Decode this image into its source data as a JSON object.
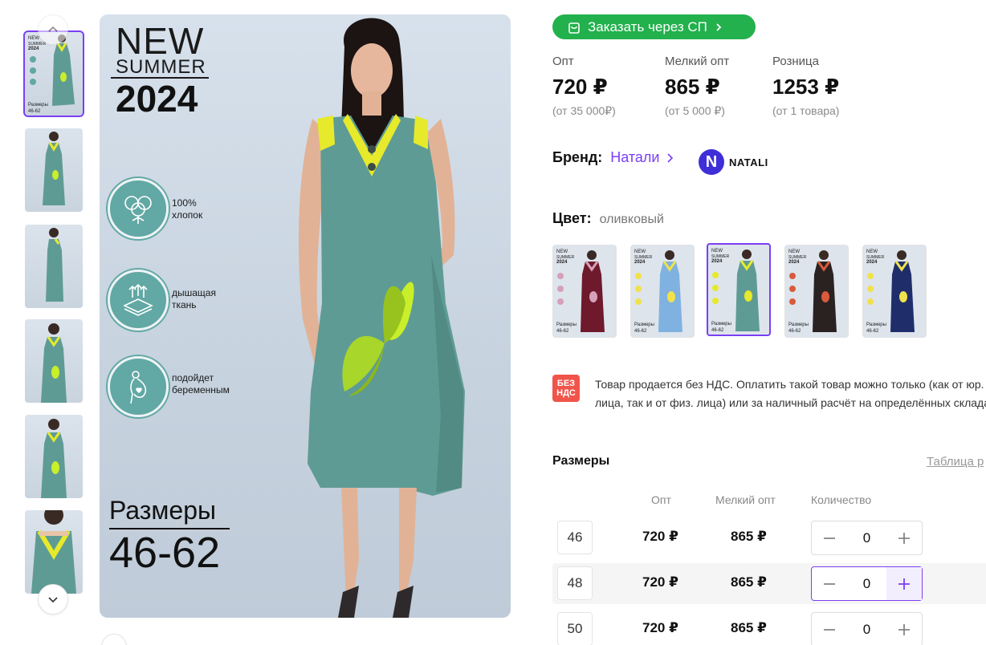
{
  "gallery": {
    "promo_new": "NEW",
    "promo_summer": "SUMMER",
    "promo_year": "2024",
    "features": [
      {
        "icon": "cotton-icon",
        "text": "100%\nхлопок"
      },
      {
        "icon": "breathable-fabric-icon",
        "text": "дышащая\nткань"
      },
      {
        "icon": "pregnant-icon",
        "text": "подойдет\nбеременным"
      }
    ],
    "sizes_title": "Размеры",
    "sizes_range": "46-62",
    "thumb_sizes_caption": "Размеры\n46-62"
  },
  "order_button": {
    "label": "Заказать через СП",
    "icon": "shopping-bag-icon"
  },
  "prices": [
    {
      "label": "Опт",
      "value": "720 ₽",
      "note": "(от 35 000₽)"
    },
    {
      "label": "Мелкий опт",
      "value": "865 ₽",
      "note": "(от 5 000 ₽)"
    },
    {
      "label": "Розница",
      "value": "1253 ₽",
      "note": "(от 1 товара)"
    }
  ],
  "brand": {
    "label": "Бренд:",
    "name": "Натали",
    "logo_letter": "N",
    "logo_text": "NATALI",
    "logo_color": "#3f2fd8"
  },
  "color": {
    "label": "Цвет:",
    "value": "оливковый",
    "swatches": [
      {
        "name": "burgundy",
        "dress": "#6e1a2c",
        "accent": "#d6a0b8"
      },
      {
        "name": "light-blue",
        "dress": "#7fb2e0",
        "accent": "#f0e24a"
      },
      {
        "name": "olive",
        "dress": "#5f9b95",
        "accent": "#e6ea2a"
      },
      {
        "name": "black-floral",
        "dress": "#2a2220",
        "accent": "#d95a3c"
      },
      {
        "name": "navy",
        "dress": "#1f2e6b",
        "accent": "#f0e24a"
      }
    ]
  },
  "nds": {
    "badge": "БЕЗ НДС",
    "text": "Товар продается без НДС. Оплатить такой товар можно только (как от юр. лица, так и от физ. лица) или за наличный расчёт на определённых складах"
  },
  "sizes": {
    "title": "Размеры",
    "table_link": "Таблица р",
    "headers": {
      "opt": "Опт",
      "small_opt": "Мелкий опт",
      "qty": "Количество"
    },
    "rows": [
      {
        "size": "46",
        "opt": "720 ₽",
        "small_opt": "865 ₽",
        "qty": "0"
      },
      {
        "size": "48",
        "opt": "720 ₽",
        "small_opt": "865 ₽",
        "qty": "0"
      },
      {
        "size": "50",
        "opt": "720 ₽",
        "small_opt": "865 ₽",
        "qty": "0"
      }
    ]
  },
  "colors": {
    "accent": "#7b3ff2",
    "green": "#22b14c",
    "teal": "#62a8a4",
    "dress": "#5f9b95",
    "collar": "#e6ea2a"
  }
}
